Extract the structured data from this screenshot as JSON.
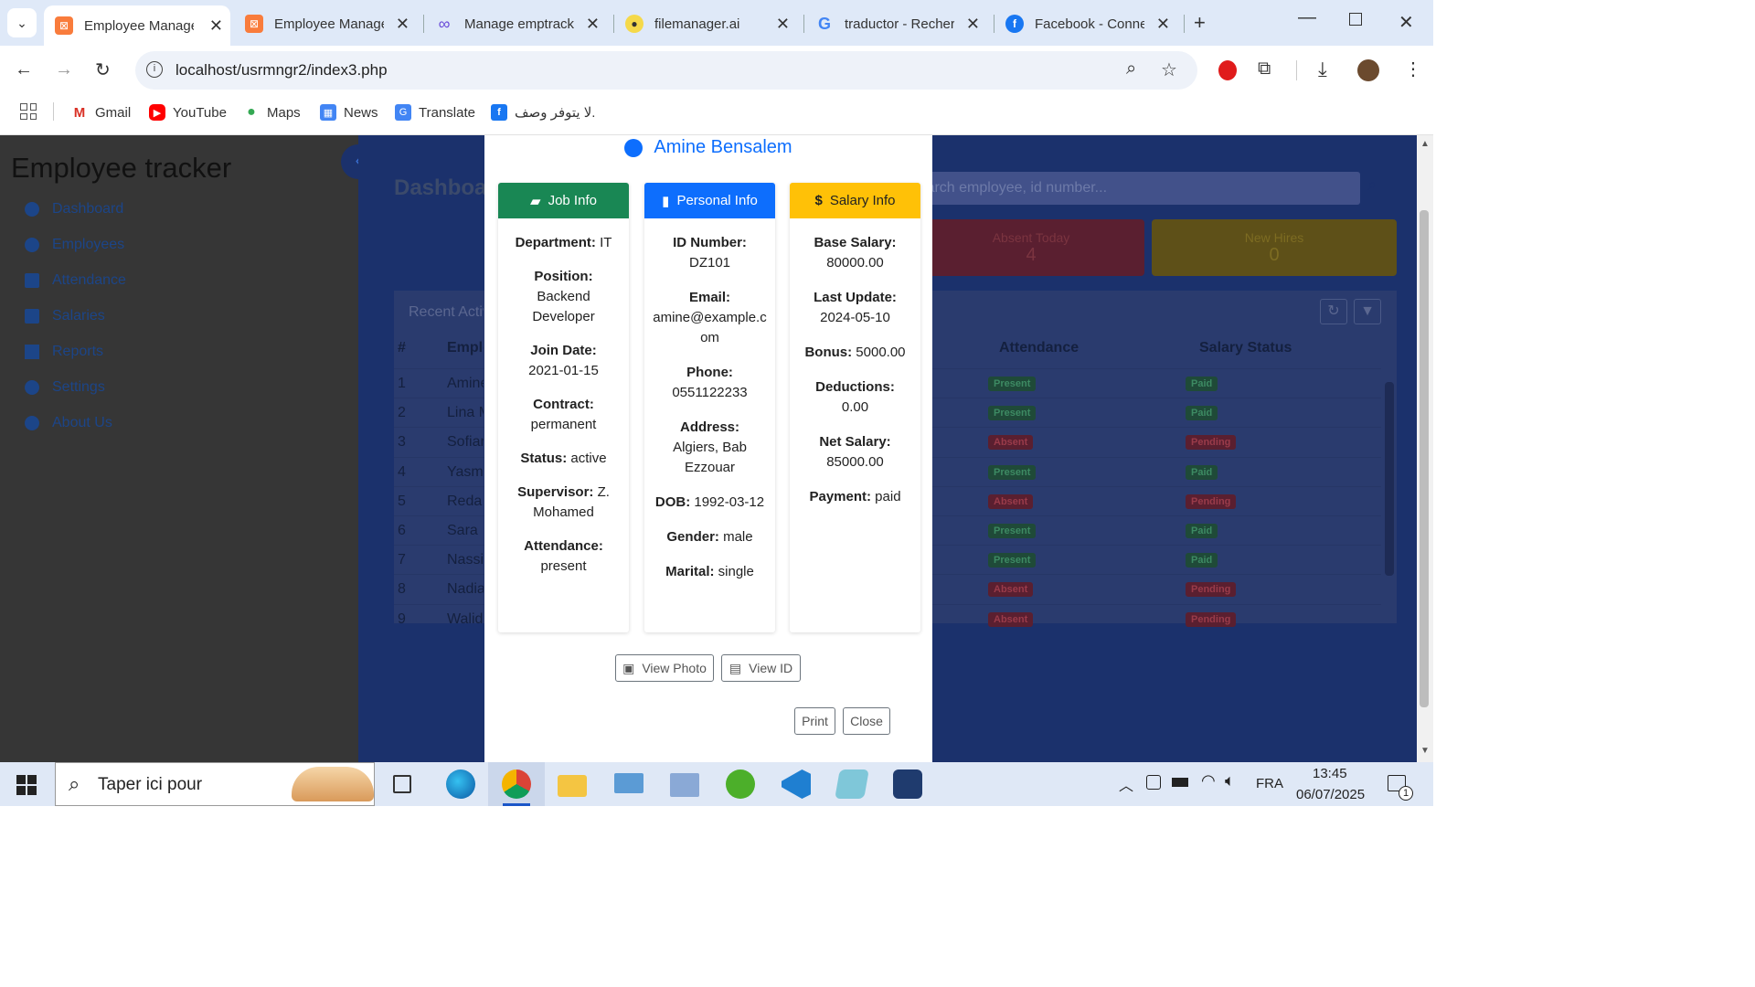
{
  "browser": {
    "tabs": [
      {
        "title": "Employee Manager",
        "favicon": "xampp-icon"
      },
      {
        "title": "Employee Manager",
        "favicon": "xampp-icon"
      },
      {
        "title": "Manage emptracker",
        "favicon": "infinity-icon"
      },
      {
        "title": "filemanager.ai",
        "favicon": "filemanager-icon"
      },
      {
        "title": "traductor - Recherche",
        "favicon": "google-icon"
      },
      {
        "title": "Facebook - Connexion",
        "favicon": "facebook-icon"
      }
    ],
    "url": "localhost/usrmngr2/index3.php",
    "bookmarks": [
      "Gmail",
      "YouTube",
      "Maps",
      "News",
      "Translate",
      "لا يتوفر وصف."
    ]
  },
  "app": {
    "title": "Employee tracker",
    "nav": [
      "Dashboard",
      "Employees",
      "Attendance",
      "Salaries",
      "Reports",
      "Settings",
      "About Us"
    ],
    "dashboard_title": "Dashboard",
    "search_placeholder": "Search employee, id number...",
    "stats": [
      {
        "label": "Absent Today",
        "value": "4"
      },
      {
        "label": "New Hires",
        "value": "0"
      }
    ],
    "recent_label": "Recent Activity",
    "table_headers": [
      "#",
      "Employee",
      "Attendance",
      "Salary Status"
    ],
    "rows": [
      {
        "n": "1",
        "name": "Amine",
        "att": "Present",
        "sal": "Paid"
      },
      {
        "n": "2",
        "name": "Lina M",
        "att": "Present",
        "sal": "Paid"
      },
      {
        "n": "3",
        "name": "Sofian",
        "att": "Absent",
        "sal": "Pending"
      },
      {
        "n": "4",
        "name": "Yasmi",
        "att": "Present",
        "sal": "Paid"
      },
      {
        "n": "5",
        "name": "Reda",
        "att": "Absent",
        "sal": "Pending"
      },
      {
        "n": "6",
        "name": "Sara",
        "att": "Present",
        "sal": "Paid"
      },
      {
        "n": "7",
        "name": "Nassi",
        "att": "Present",
        "sal": "Paid"
      },
      {
        "n": "8",
        "name": "Nadia",
        "att": "Absent",
        "sal": "Pending"
      },
      {
        "n": "9",
        "name": "Walid",
        "att": "Absent",
        "sal": "Pending"
      }
    ]
  },
  "modal": {
    "employee_name": "Amine Bensalem",
    "job": {
      "header": "Job Info",
      "department": "IT",
      "position": "Backend Developer",
      "join_date": "2021-01-15",
      "contract": "permanent",
      "status": "active",
      "supervisor": "Z. Mohamed",
      "attendance": "present"
    },
    "personal": {
      "header": "Personal Info",
      "id_number": "DZ101",
      "email": "amine@example.com",
      "phone": "0551122233",
      "address": "Algiers, Bab Ezzouar",
      "dob": "1992-03-12",
      "gender": "male",
      "marital": "single"
    },
    "salary": {
      "header": "Salary Info",
      "base_salary": "80000.00",
      "last_update": "2024-05-10",
      "bonus": "5000.00",
      "deductions": "0.00",
      "net_salary": "85000.00",
      "payment": "paid"
    },
    "labels": {
      "department": "Department:",
      "position": "Position:",
      "join_date": "Join Date:",
      "contract": "Contract:",
      "status": "Status:",
      "supervisor": "Supervisor:",
      "attendance": "Attendance:",
      "id_number": "ID Number:",
      "email": "Email:",
      "phone": "Phone:",
      "address": "Address:",
      "dob": "DOB:",
      "gender": "Gender:",
      "marital": "Marital:",
      "base_salary": "Base Salary:",
      "last_update": "Last Update:",
      "bonus": "Bonus:",
      "deductions": "Deductions:",
      "net_salary": "Net Salary:",
      "payment": "Payment:"
    },
    "view_photo": "View Photo",
    "view_id": "View ID",
    "print": "Print",
    "close": "Close"
  },
  "taskbar": {
    "search": "Taper ici pour",
    "time": "13:45",
    "date": "06/07/2025",
    "lang": "FRA",
    "notif": "1"
  },
  "colors": {
    "job": "#198754",
    "personal": "#0d6efd",
    "salary": "#ffc107",
    "brand": "#0d6efd"
  }
}
